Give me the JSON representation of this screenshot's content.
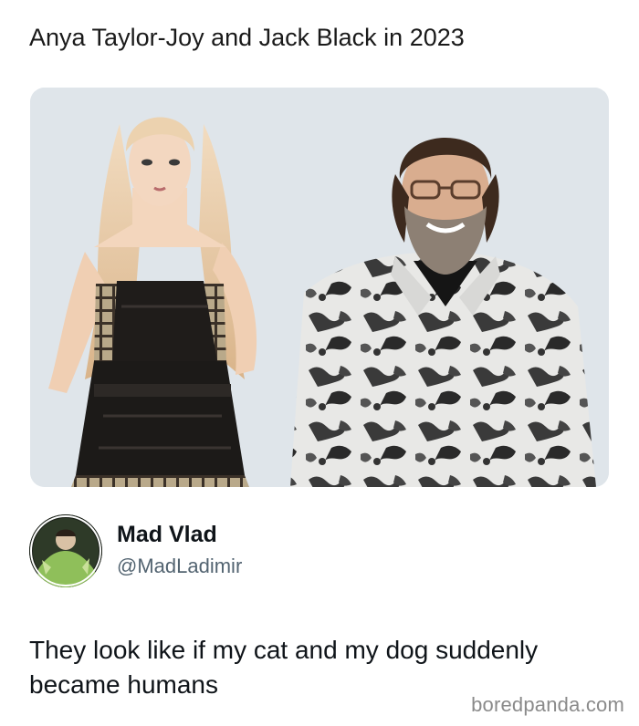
{
  "post": {
    "caption": "Anya Taylor-Joy and Jack Black in 2023",
    "photo_icon": "photo-of-two-people",
    "tweet": {
      "display_name": "Mad Vlad",
      "handle": "@MadLadimir",
      "text": "They look like if my cat and my dog suddenly became humans",
      "avatar_icon": "profile-avatar"
    }
  },
  "watermark": "boredpanda.com",
  "colors": {
    "photo_background": "#dfe5ea",
    "text_primary": "#0f1419",
    "text_secondary": "#536471",
    "watermark": "#8a8a8a"
  }
}
